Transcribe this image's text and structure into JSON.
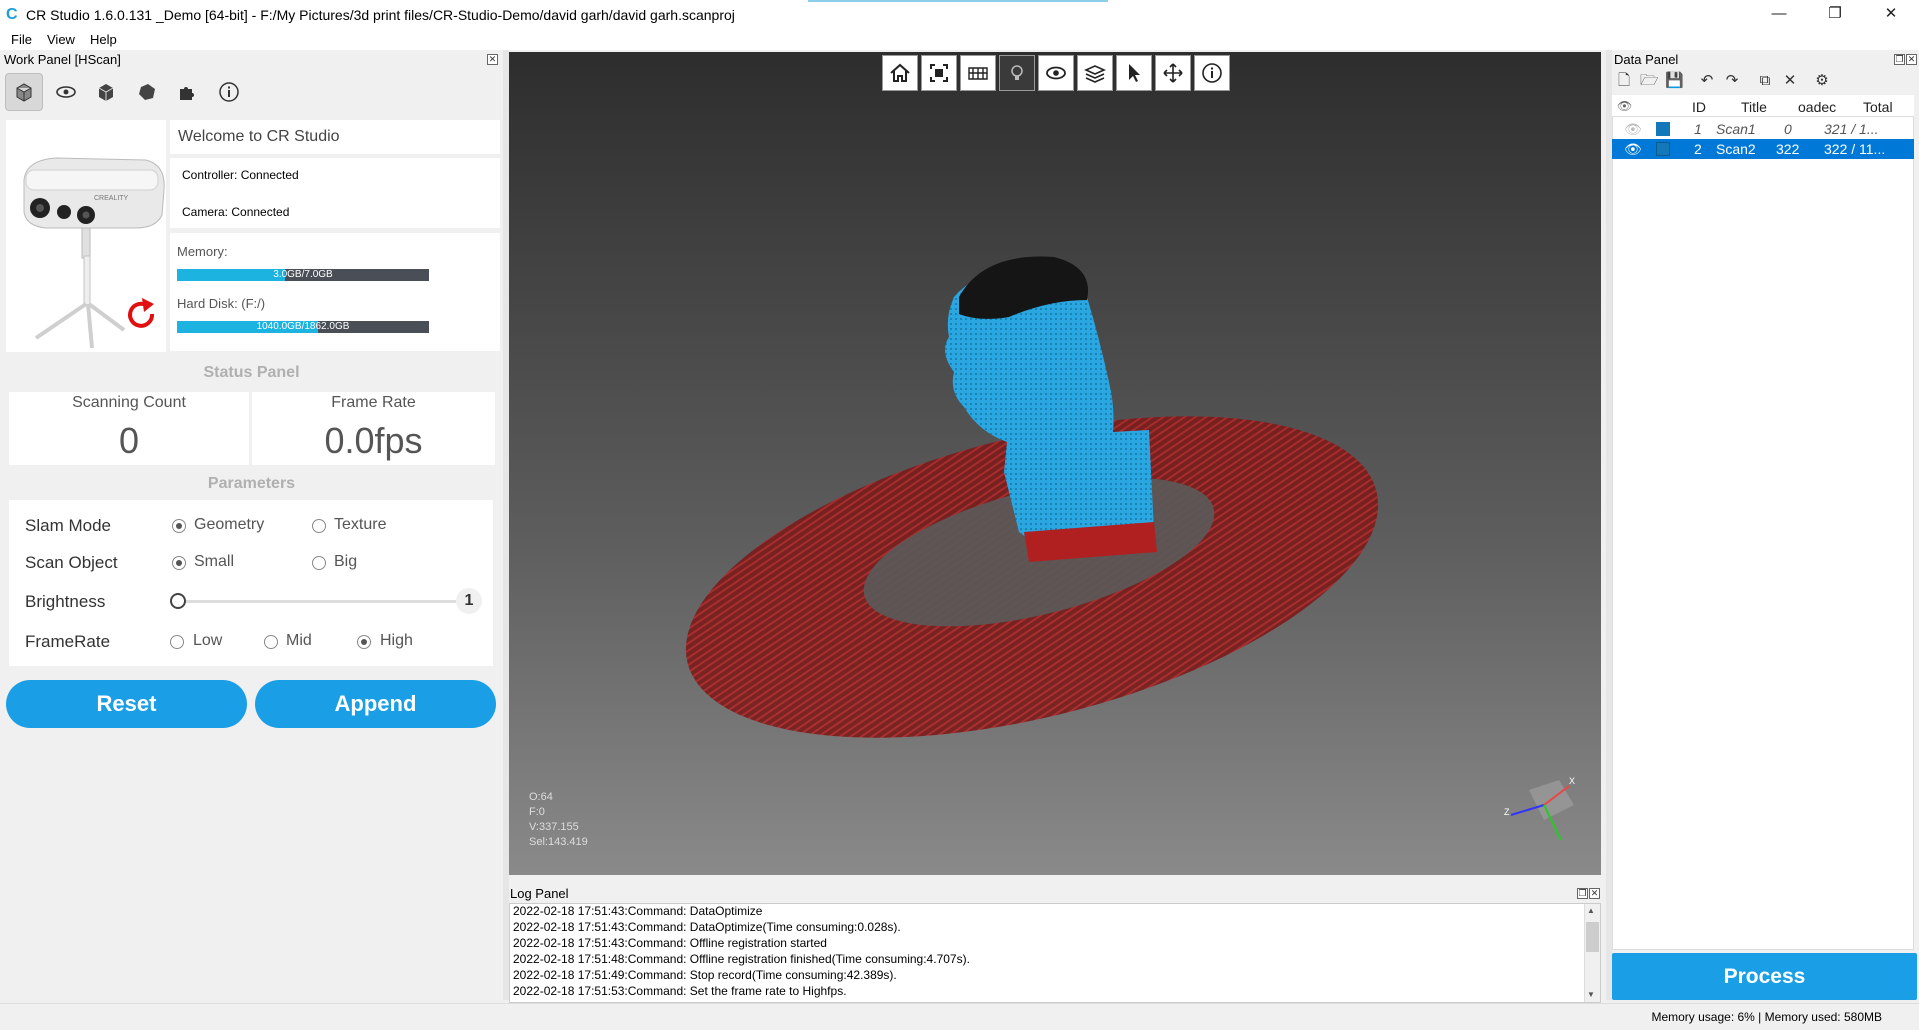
{
  "window": {
    "title": "CR Studio 1.6.0.131 _Demo [64-bit] - F:/My Pictures/3d print files/CR-Studio-Demo/david garh/david garh.scanproj",
    "minimize_glyph": "—",
    "maximize_glyph": "❐",
    "close_glyph": "✕"
  },
  "menu": {
    "file": "File",
    "view": "View",
    "help": "Help"
  },
  "work_panel": {
    "header": "Work Panel [HScan]",
    "toolbar_icons": [
      "cube-icon",
      "eye-icon",
      "box-icon",
      "solid-icon",
      "puzzle-icon",
      "info-icon"
    ],
    "welcome": "Welcome to CR Studio",
    "controller": "Controller: Connected",
    "camera": "Camera: Connected",
    "memory_label": "Memory:",
    "memory_value": "3.0GB/7.0GB",
    "memory_fraction": 0.43,
    "disk_label": "Hard Disk: (F:/)",
    "disk_value": "1040.0GB/1862.0GB",
    "disk_fraction": 0.56,
    "brand": "CREALITY"
  },
  "status_panel": {
    "title": "Status Panel",
    "scanning_count_label": "Scanning Count",
    "scanning_count": "0",
    "frame_rate_label": "Frame Rate",
    "frame_rate": "0.0fps"
  },
  "parameters": {
    "title": "Parameters",
    "slam_mode": {
      "label": "Slam Mode",
      "options": [
        "Geometry",
        "Texture"
      ],
      "selected": "Geometry"
    },
    "scan_object": {
      "label": "Scan Object",
      "options": [
        "Small",
        "Big"
      ],
      "selected": "Small"
    },
    "brightness": {
      "label": "Brightness",
      "value": "1"
    },
    "frame_rate": {
      "label": "FrameRate",
      "options": [
        "Low",
        "Mid",
        "High"
      ],
      "selected": "High"
    }
  },
  "buttons": {
    "reset": "Reset",
    "append": "Append",
    "process": "Process"
  },
  "viewport": {
    "toolbar_icons": [
      "home-icon",
      "fit-view-icon",
      "perspective-icon",
      "light-icon",
      "eye-icon",
      "layers-icon",
      "pointer-icon",
      "move-icon",
      "info-icon"
    ],
    "stats": [
      "O:64",
      "F:0",
      "V:337.155",
      "Sel:143.419"
    ],
    "axis_labels": {
      "x": "X",
      "z": "Z"
    }
  },
  "log_panel": {
    "header": "Log Panel",
    "lines": [
      "2022-02-18 17:51:43:Command: DataOptimize",
      "2022-02-18 17:51:43:Command: DataOptimize(Time consuming:0.028s).",
      "2022-02-18 17:51:43:Command: Offline registration started",
      "2022-02-18 17:51:48:Command: Offline registration finished(Time consuming:4.707s).",
      "2022-02-18 17:51:49:Command: Stop record(Time consuming:42.389s).",
      "2022-02-18 17:51:53:Command: Set the frame rate to Highfps."
    ]
  },
  "data_panel": {
    "header": "Data Panel",
    "columns": [
      "ID",
      "Title",
      "oadec",
      "Total"
    ],
    "rows": [
      {
        "id": "1",
        "title": "Scan1",
        "loaded": "0",
        "total": "321 / 1...",
        "color": "#1278b8",
        "selected": false
      },
      {
        "id": "2",
        "title": "Scan2",
        "loaded": "322",
        "total": "322 / 11...",
        "color": "#1278b8",
        "selected": true
      }
    ]
  },
  "statusbar": {
    "text": "Memory usage: 6% | Memory used: 580MB"
  },
  "colors": {
    "accent": "#1a9fe6",
    "selection": "#0078d7",
    "scan_blue": "#2aa6e0",
    "scan_red": "#a02020"
  }
}
